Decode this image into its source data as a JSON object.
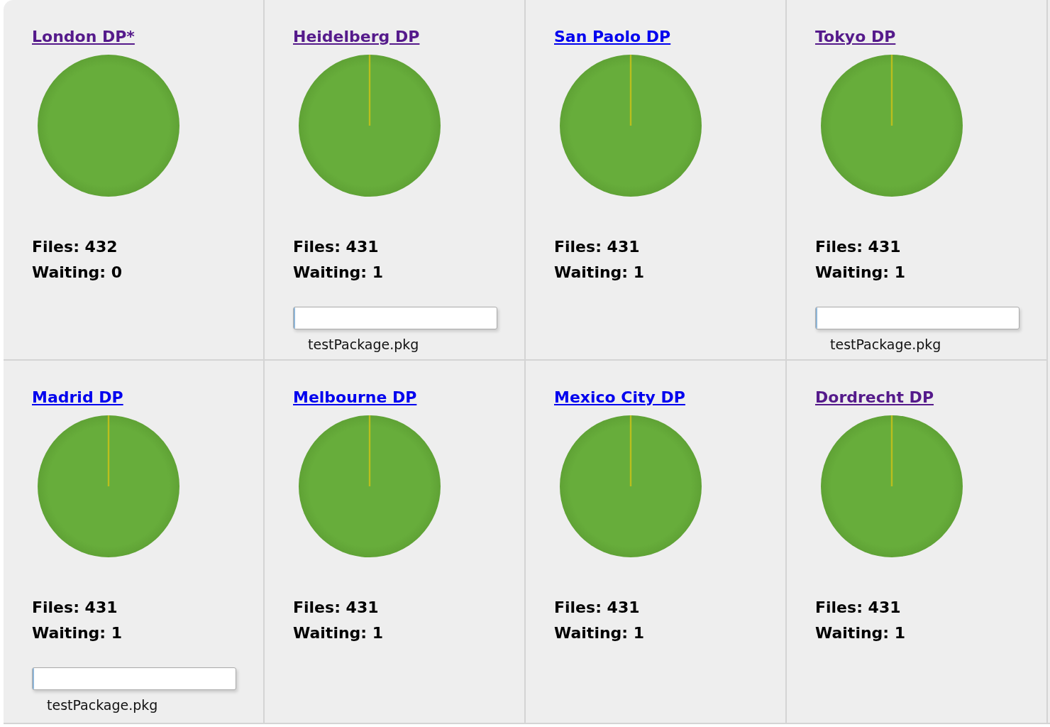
{
  "points": [
    {
      "name": "London DP*",
      "visited": true,
      "pending_slice": false,
      "files": "Files: 432",
      "waiting": "Waiting: 0"
    },
    {
      "name": "Heidelberg DP",
      "visited": true,
      "pending_slice": true,
      "files": "Files: 431",
      "waiting": "Waiting: 1",
      "transfer": {
        "level": 0.005,
        "file": "testPackage.pkg"
      }
    },
    {
      "name": "San Paolo DP",
      "visited": false,
      "pending_slice": true,
      "files": "Files: 431",
      "waiting": "Waiting: 1"
    },
    {
      "name": "Tokyo DP",
      "visited": true,
      "pending_slice": true,
      "files": "Files: 431",
      "waiting": "Waiting: 1",
      "transfer": {
        "level": 0.005,
        "file": "testPackage.pkg"
      }
    },
    {
      "name": "Madrid DP",
      "visited": false,
      "pending_slice": true,
      "files": "Files: 431",
      "waiting": "Waiting: 1",
      "transfer": {
        "level": 0.005,
        "file": "testPackage.pkg"
      }
    },
    {
      "name": "Melbourne DP",
      "visited": false,
      "pending_slice": true,
      "files": "Files: 431",
      "waiting": "Waiting: 1"
    },
    {
      "name": "Mexico City DP",
      "visited": false,
      "pending_slice": true,
      "files": "Files: 431",
      "waiting": "Waiting: 1"
    },
    {
      "name": "Dordrecht DP",
      "visited": true,
      "pending_slice": true,
      "files": "Files: 431",
      "waiting": "Waiting: 1"
    }
  ]
}
